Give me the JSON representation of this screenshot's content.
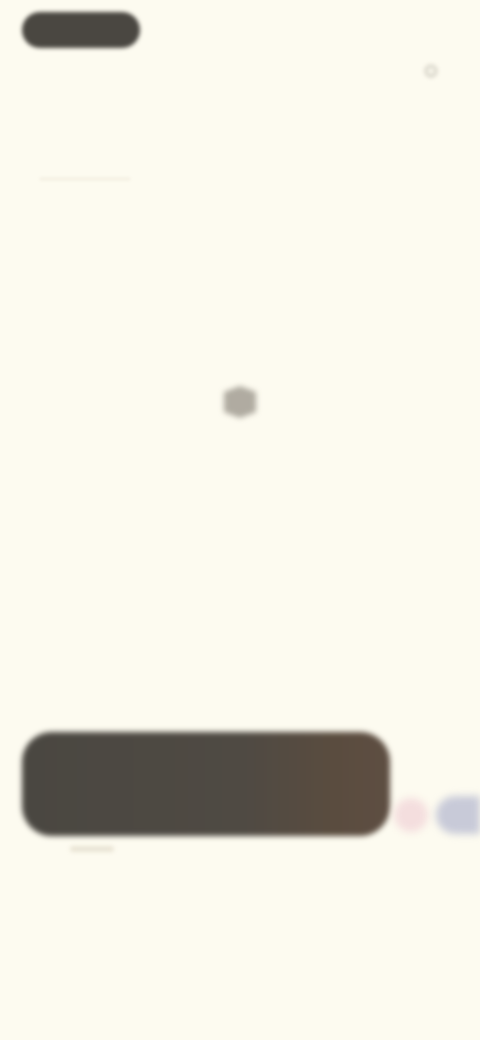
{
  "header": {
    "title": "",
    "filter_label": ""
  },
  "section": {
    "label": ""
  },
  "empty_state": {
    "title": "",
    "description": ""
  },
  "composer": {
    "placeholder": ""
  },
  "tabs": [
    {
      "label": ""
    },
    {
      "label": ""
    },
    {
      "label": ""
    }
  ],
  "bottom_nav": [
    {
      "label": ""
    },
    {
      "label": ""
    },
    {
      "label": ""
    }
  ],
  "icons": {
    "filter": "filter-icon",
    "empty": "empty-state-icon"
  },
  "colors": {
    "background": "#fdfbf0",
    "composer": "#4a4741",
    "accent_pink": "#f4dede",
    "accent_blue": "#c8cad8"
  }
}
